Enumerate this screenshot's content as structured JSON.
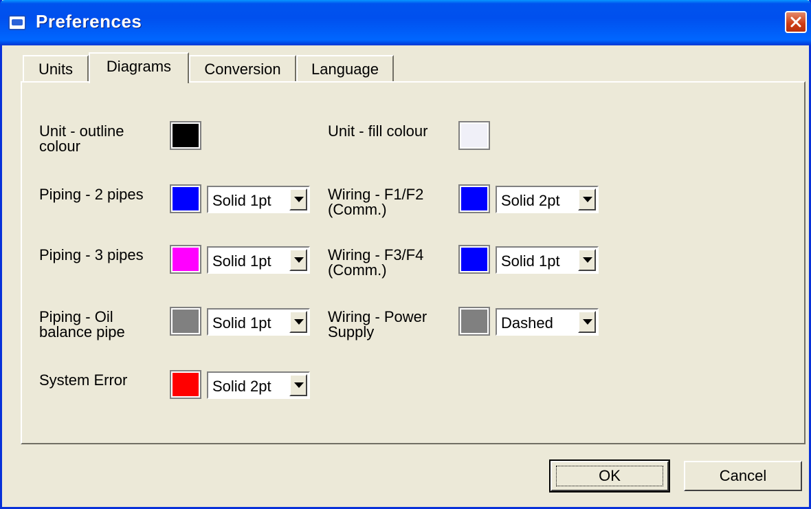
{
  "window": {
    "title": "Preferences"
  },
  "tabs": [
    {
      "label": "Units"
    },
    {
      "label": "Diagrams"
    },
    {
      "label": "Conversion"
    },
    {
      "label": "Language"
    }
  ],
  "active_tab": "Diagrams",
  "settings": [
    {
      "label_lines": [
        "Unit - outline",
        "colour"
      ],
      "color": "#000000"
    },
    {
      "label_lines": [
        "Unit - fill colour"
      ],
      "color": "#f0f0f8"
    },
    {
      "label_lines": [
        "Piping - 2 pipes"
      ],
      "color": "#0000ff",
      "style": "Solid 1pt"
    },
    {
      "label_lines": [
        "Wiring - F1/F2",
        "(Comm.)"
      ],
      "color": "#0000ff",
      "style": "Solid 2pt"
    },
    {
      "label_lines": [
        "Piping - 3 pipes"
      ],
      "color": "#ff00ff",
      "style": "Solid 1pt"
    },
    {
      "label_lines": [
        "Wiring - F3/F4",
        "(Comm.)"
      ],
      "color": "#0000ff",
      "style": "Solid 1pt"
    },
    {
      "label_lines": [
        "Piping - Oil",
        "balance pipe"
      ],
      "color": "#808080",
      "style": "Solid 1pt"
    },
    {
      "label_lines": [
        "Wiring - Power",
        "Supply"
      ],
      "color": "#808080",
      "style": "Dashed"
    },
    {
      "label_lines": [
        "System Error"
      ],
      "color": "#ff0000",
      "style": "Solid 2pt"
    }
  ],
  "buttons": {
    "ok": "OK",
    "cancel": "Cancel"
  },
  "icons": {
    "app": "app-icon",
    "close": "close-icon",
    "dropdown": "chevron-down-icon"
  }
}
